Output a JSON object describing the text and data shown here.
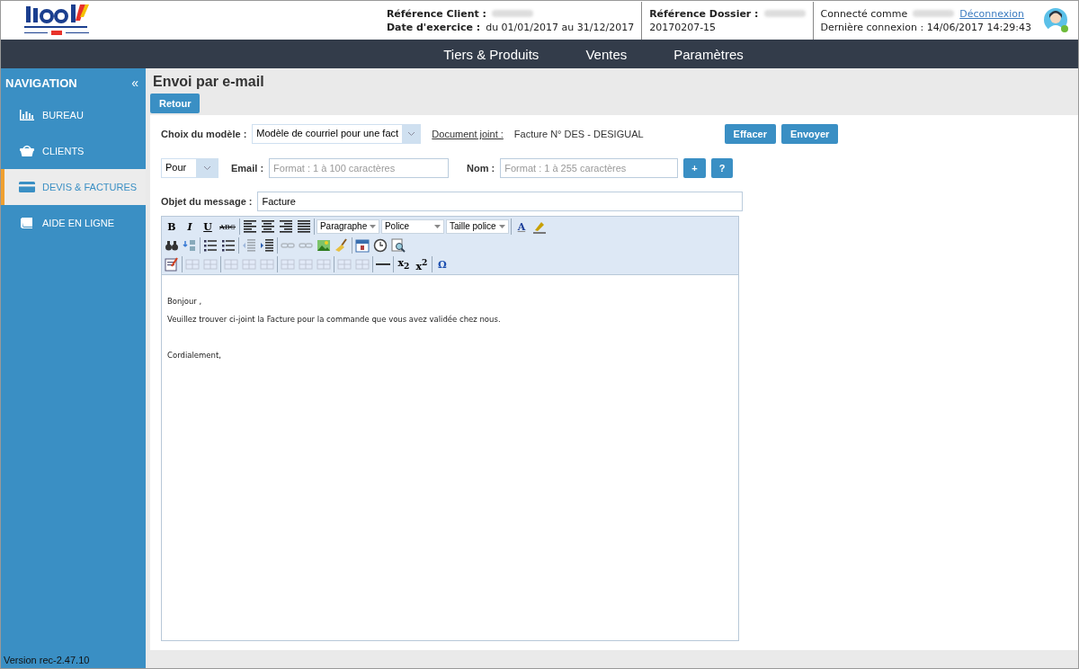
{
  "header": {
    "client_label": "Référence Client :",
    "exercise_label": "Date d'exercice :",
    "exercise_value": "du 01/01/2017 au 31/12/2017",
    "dossier_label": "Référence Dossier :",
    "dossier_value": "20170207-15",
    "connected_label": "Connecté comme",
    "logout_link": "Déconnexion",
    "last_login": "Dernière connexion : 14/06/2017 14:29:43"
  },
  "top_menu": [
    {
      "label": "Tiers & Produits"
    },
    {
      "label": "Ventes"
    },
    {
      "label": "Paramètres"
    }
  ],
  "sidebar": {
    "title": "NAVIGATION",
    "collapse": "«",
    "items": [
      {
        "label": "BUREAU",
        "selected": false
      },
      {
        "label": "CLIENTS",
        "selected": false
      },
      {
        "label": "DEVIS & FACTURES",
        "selected": true
      },
      {
        "label": "AIDE EN LIGNE",
        "selected": false
      }
    ],
    "version": "Version rec-2.47.10"
  },
  "page": {
    "title": "Envoi par e-mail",
    "back_button": "Retour"
  },
  "form": {
    "model_label": "Choix du modèle :",
    "model_value": "Modèle de courriel pour une  fact",
    "attachment_label": "Document joint :",
    "attachment_value": "Facture N° DES - DESIGUAL",
    "clear_button": "Effacer",
    "send_button": "Envoyer",
    "recipient_type": "Pour",
    "email_label": "Email :",
    "email_placeholder": "Format : 1 à 100 caractères",
    "name_label": "Nom :",
    "name_placeholder": "Format : 1 à 255 caractères",
    "add_button": "+",
    "help_button": "?",
    "subject_label": "Objet du message :",
    "subject_value": "Facture"
  },
  "toolbar_rows": [
    [
      {
        "kind": "glyph",
        "label": "B"
      },
      {
        "kind": "glyph",
        "label": "I"
      },
      {
        "kind": "glyph",
        "label": "U"
      },
      {
        "kind": "glyph",
        "label": "ABC"
      },
      {
        "kind": "sep"
      },
      {
        "kind": "icon",
        "disabled": false
      },
      {
        "kind": "icon",
        "disabled": false
      },
      {
        "kind": "icon",
        "disabled": false
      },
      {
        "kind": "icon",
        "disabled": false
      },
      {
        "kind": "sep"
      },
      {
        "kind": "dropdown",
        "label": "Paragraphe"
      },
      {
        "kind": "dropdown",
        "label": "Police"
      },
      {
        "kind": "dropdown",
        "label": "Taille police"
      },
      {
        "kind": "sep"
      },
      {
        "kind": "glyph",
        "label": "A"
      },
      {
        "kind": "icon",
        "disabled": false
      }
    ],
    [
      {
        "kind": "icon",
        "disabled": false
      },
      {
        "kind": "icon",
        "disabled": false
      },
      {
        "kind": "sep"
      },
      {
        "kind": "icon",
        "disabled": false
      },
      {
        "kind": "icon",
        "disabled": false
      },
      {
        "kind": "sep"
      },
      {
        "kind": "icon",
        "disabled": true
      },
      {
        "kind": "icon",
        "disabled": false
      },
      {
        "kind": "sep"
      },
      {
        "kind": "icon",
        "disabled": true
      },
      {
        "kind": "icon",
        "disabled": true
      },
      {
        "kind": "icon",
        "disabled": false
      },
      {
        "kind": "icon",
        "disabled": false
      },
      {
        "kind": "sep"
      },
      {
        "kind": "icon",
        "disabled": false
      },
      {
        "kind": "icon",
        "disabled": false
      },
      {
        "kind": "icon",
        "disabled": false
      }
    ],
    [
      {
        "kind": "icon",
        "disabled": false
      },
      {
        "kind": "sep"
      },
      {
        "kind": "icon",
        "disabled": true
      },
      {
        "kind": "icon",
        "disabled": true
      },
      {
        "kind": "sep"
      },
      {
        "kind": "icon",
        "disabled": true
      },
      {
        "kind": "icon",
        "disabled": true
      },
      {
        "kind": "icon",
        "disabled": true
      },
      {
        "kind": "sep"
      },
      {
        "kind": "icon",
        "disabled": true
      },
      {
        "kind": "icon",
        "disabled": true
      },
      {
        "kind": "icon",
        "disabled": true
      },
      {
        "kind": "sep"
      },
      {
        "kind": "icon",
        "disabled": true
      },
      {
        "kind": "icon",
        "disabled": true
      },
      {
        "kind": "sep"
      },
      {
        "kind": "icon",
        "disabled": false
      },
      {
        "kind": "sep"
      },
      {
        "kind": "glyph",
        "label": "x$_{2}$"
      },
      {
        "kind": "glyph",
        "label": "x$^{2}$"
      },
      {
        "kind": "sep"
      },
      {
        "kind": "glyph",
        "label": "Ω"
      }
    ]
  ],
  "message": [
    "Bonjour   ,",
    "Veuillez trouver ci-joint la Facture   pour la commande que vous avez validée chez nous.",
    "Cordialement,"
  ]
}
